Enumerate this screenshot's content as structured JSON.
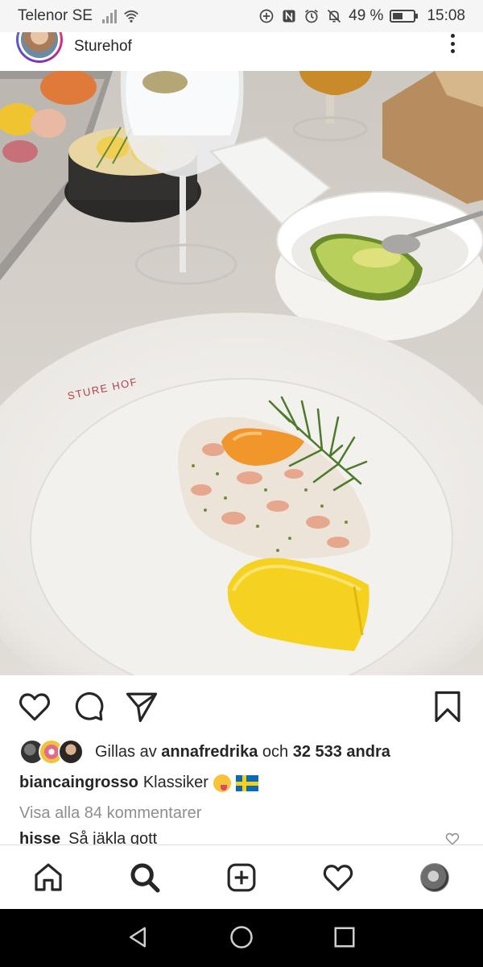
{
  "status_bar": {
    "carrier": "Telenor SE",
    "battery": "49 %",
    "battery_level": 0.49,
    "time": "15:08",
    "icons": [
      "signal-icon",
      "wifi-icon",
      "data-saver-icon",
      "nfc-icon",
      "alarm-icon",
      "mute-icon",
      "battery-icon"
    ]
  },
  "post": {
    "username_partial": "biancaingrosso",
    "location": "Sturehof",
    "plate_text": "STURE HOF"
  },
  "actions": {
    "icons": [
      "heart-icon",
      "comment-icon",
      "share-icon",
      "bookmark-icon"
    ]
  },
  "likes": {
    "prefix": "Gillas av",
    "user": "annafredrika",
    "middle": "och",
    "count": "32 533 andra"
  },
  "caption": {
    "user": "biancaingrosso",
    "text": "Klassiker"
  },
  "comments": {
    "view_all": "Visa alla 84 kommentarer",
    "items": [
      {
        "user": "hisse",
        "text": "Så jäkla gott"
      }
    ]
  },
  "nav": {
    "items": [
      "home-icon",
      "search-icon",
      "new-post-icon",
      "activity-icon",
      "profile-avatar"
    ]
  },
  "colors": {
    "text": "#262626",
    "muted": "#8e8e8e",
    "status_bg": "#f5f5f5"
  }
}
